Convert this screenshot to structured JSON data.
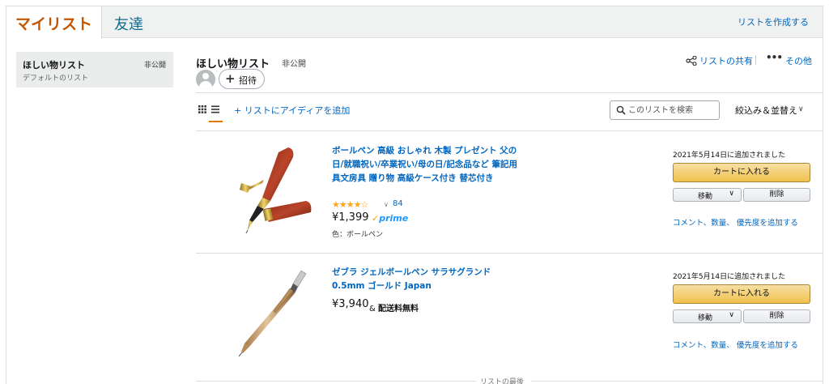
{
  "tabs": {
    "my_list": "マイリスト",
    "friends": "友達",
    "create_list": "リストを作成する"
  },
  "sidebar": {
    "items": [
      {
        "title": "ほしい物リスト",
        "subtitle": "デフォルトのリスト",
        "badge": "非公開"
      }
    ]
  },
  "list_header": {
    "title": "ほしい物リスト",
    "privacy": "非公開",
    "invite_label": "招待",
    "share_label": "リストの共有",
    "more_label": "その他"
  },
  "toolbar": {
    "add_idea": "+ リストにアイディアを追加",
    "search_placeholder": "このリストを検索",
    "filter_label": "絞込み＆並替え"
  },
  "items": [
    {
      "title": "ボールペン 高級 おしゃれ 木製 プレゼント 父の日/就職祝い/卒業祝い/母の日/記念品など 筆記用具文房具 贈り物 高級ケース付き 替芯付き",
      "rating": 3.5,
      "stars_text": "★★★★☆",
      "rating_count": "84",
      "price": "¥1,399",
      "prime_label": "prime",
      "color": "色：ボールペン",
      "added_date": "2021年5月14日に追加されました",
      "cart_label": "カートに入れる",
      "move_label": "移動",
      "delete_label": "削除",
      "add_comment": "コメント、数量、 優先度を追加する"
    },
    {
      "title": "ゼブラ ジェルボールペン サラサグランド 0.5mm ゴールド Japan",
      "price": "¥3,940",
      "shipping_prefix": "&",
      "shipping": "配送料無料",
      "added_date": "2021年5月14日に追加されました",
      "cart_label": "カートに入れる",
      "move_label": "移動",
      "delete_label": "削除",
      "add_comment": "コメント、数量、 優先度を追加する"
    }
  ],
  "list_end": "リストの最後",
  "colors": {
    "accent_orange": "#c45500",
    "link_blue": "#0066c0",
    "cart_button": "#f0c14b",
    "prime_blue": "#1a98ff",
    "star": "#ffa41c"
  }
}
